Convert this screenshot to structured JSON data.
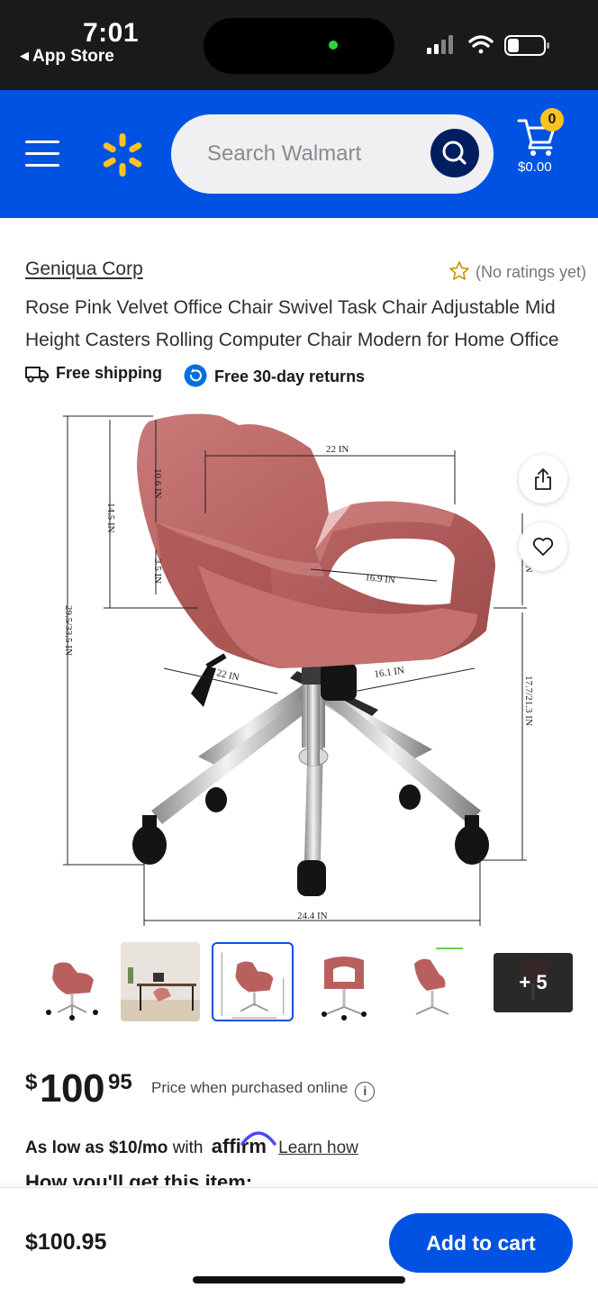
{
  "status_bar": {
    "time": "7:01",
    "back_label": "App Store"
  },
  "header": {
    "search_placeholder": "Search Walmart",
    "cart_count": "0",
    "cart_total": "$0.00",
    "brand_color": "#0053e2",
    "accent_color": "#ffc220"
  },
  "product": {
    "brand": "Geniqua Corp",
    "rating_text": "(No ratings yet)",
    "title": "Rose Pink Velvet Office Chair Swivel Task Chair Adjustable Mid Height Casters Rolling Computer Chair Modern for Home Office",
    "shipping_label": "Free shipping",
    "returns_label": "Free 30-day returns"
  },
  "hero_image": {
    "dimensions": [
      "22 IN",
      "10.6 IN",
      "14.5 IN",
      "3.5 IN",
      "29.5/33.5 IN",
      "16.9 IN",
      "IN",
      "22 IN",
      "16.1 IN",
      "17.7/21.3 IN",
      "24.4 IN"
    ]
  },
  "thumbnails": {
    "more_label": "+ 5",
    "selected_index": 2
  },
  "pricing": {
    "currency": "$",
    "whole": "100",
    "cents": "95",
    "note": "Price when purchased online",
    "affirm_prefix": "As low as $10/mo",
    "affirm_with": "with",
    "affirm_brand": "affirm",
    "learn_link": "Learn how",
    "next_heading": "How you'll get this item:"
  },
  "bottom_bar": {
    "price": "$100.95",
    "add_to_cart": "Add to cart"
  },
  "icons": {
    "back": "back-triangle-icon",
    "menu": "hamburger-menu-icon",
    "logo": "walmart-spark-icon",
    "search": "search-icon",
    "cart": "cart-icon",
    "star": "star-outline-icon",
    "truck": "truck-icon",
    "returns": "return-arrow-icon",
    "share": "share-icon",
    "heart": "heart-outline-icon",
    "info": "info-icon"
  }
}
